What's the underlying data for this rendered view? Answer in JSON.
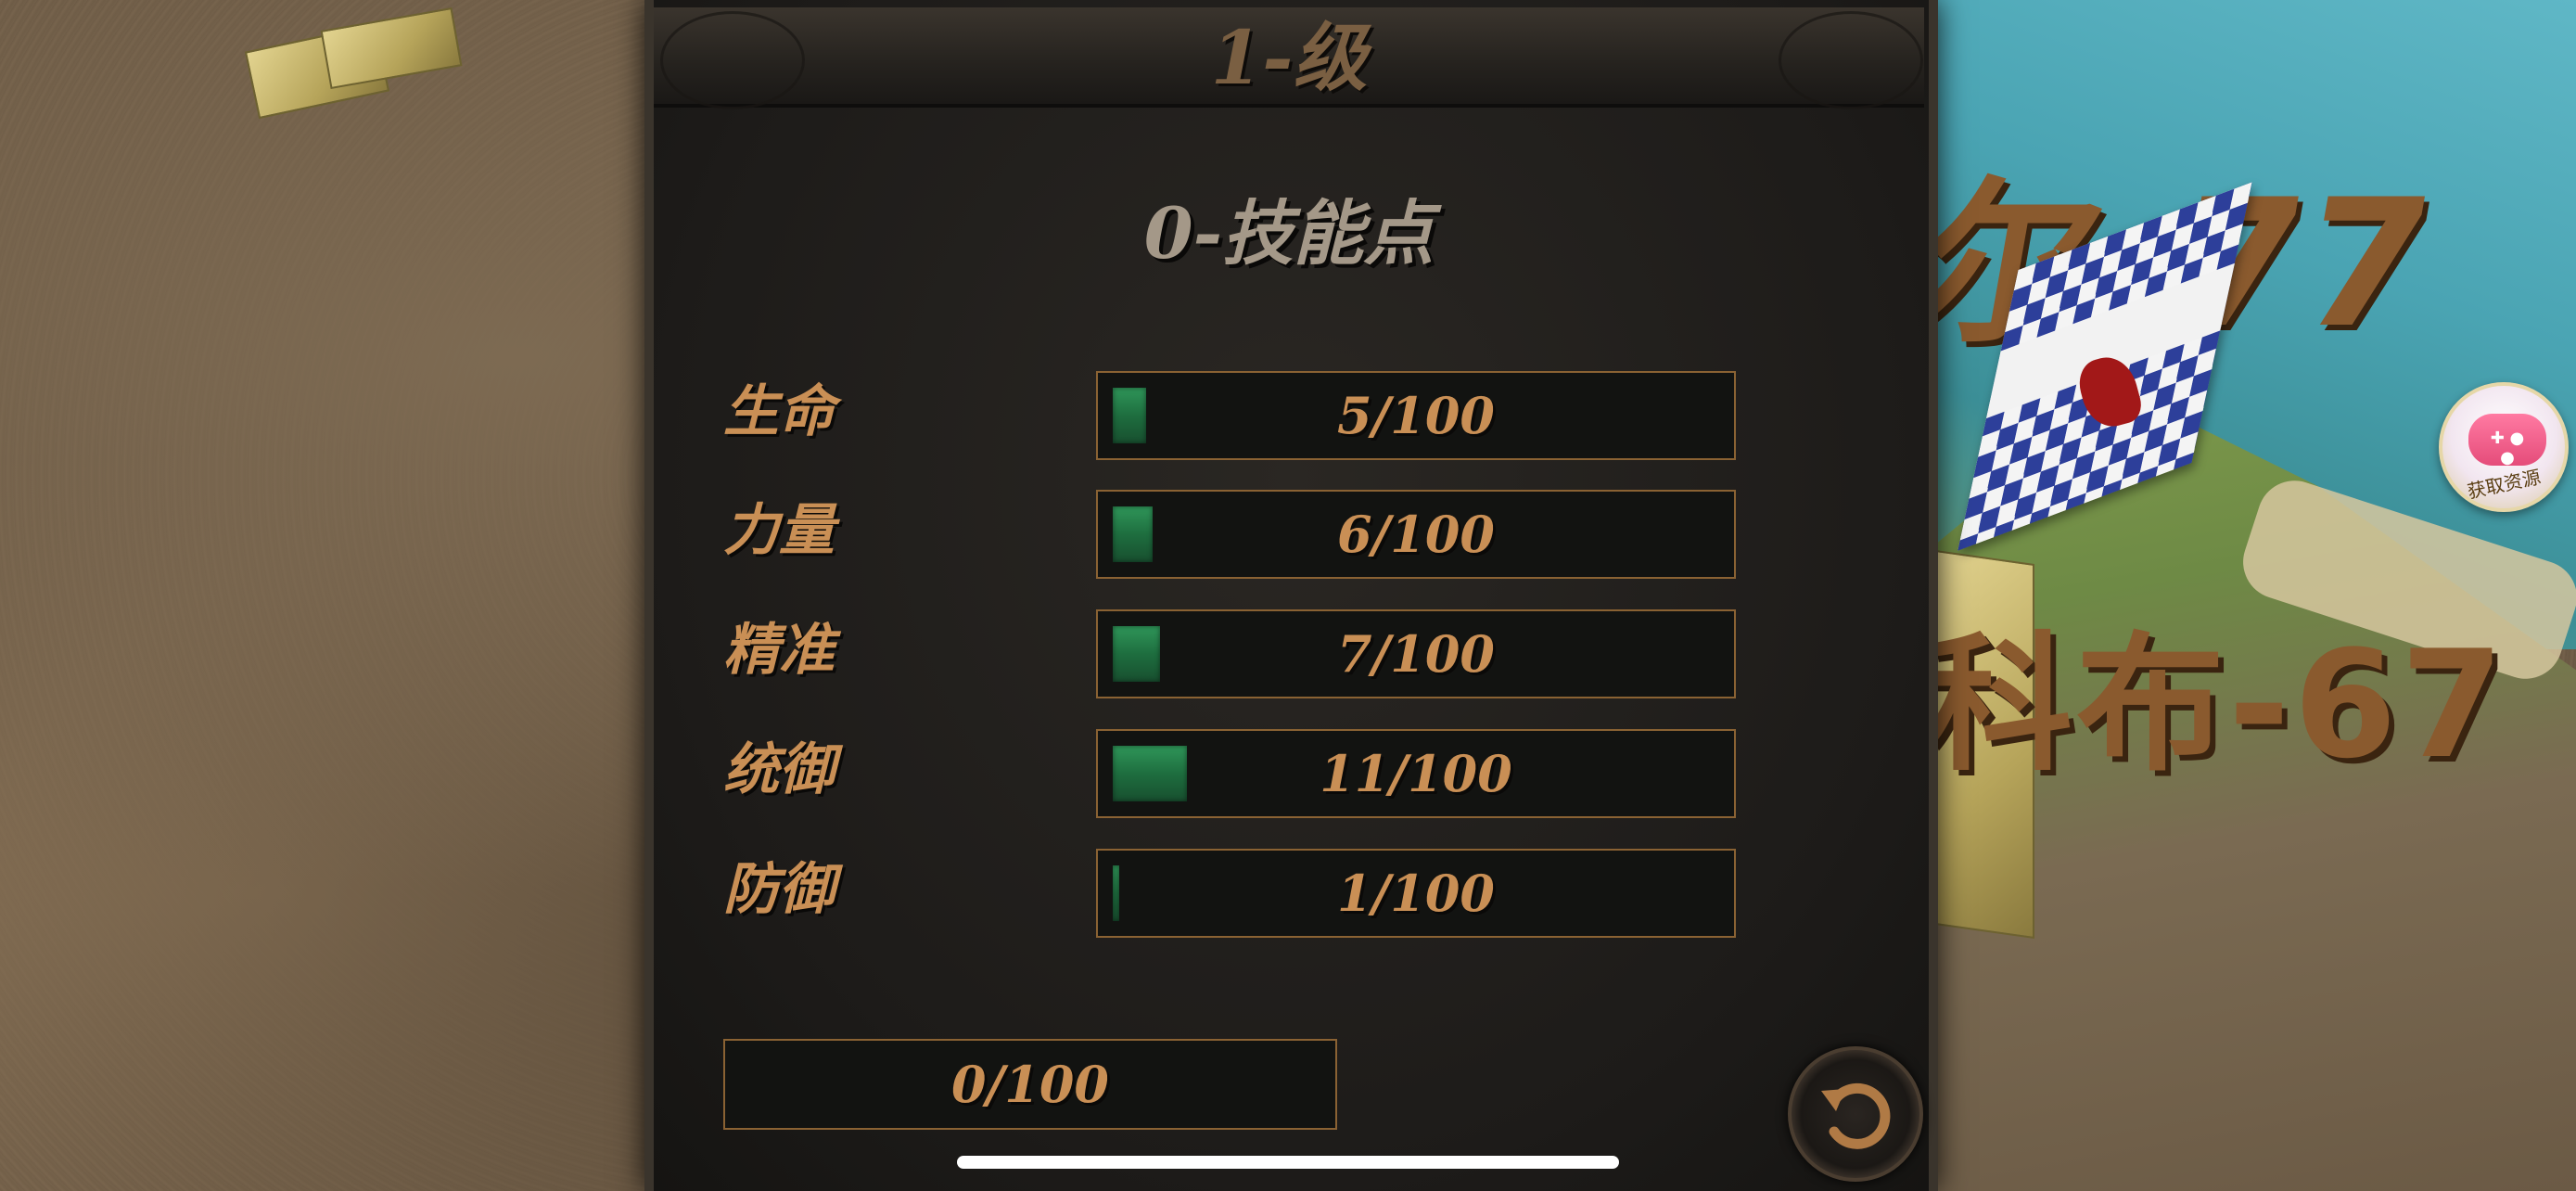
{
  "panel": {
    "title": "1-级",
    "skill_points": "0-技能点",
    "stats": [
      {
        "label": "生命",
        "value_text": "5/100",
        "value": 5,
        "max": 100
      },
      {
        "label": "力量",
        "value_text": "6/100",
        "value": 6,
        "max": 100
      },
      {
        "label": "精准",
        "value_text": "7/100",
        "value": 7,
        "max": 100
      },
      {
        "label": "统御",
        "value_text": "11/100",
        "value": 11,
        "max": 100
      },
      {
        "label": "防御",
        "value_text": "1/100",
        "value": 1,
        "max": 100
      }
    ],
    "experience": {
      "value_text": "0/100",
      "value": 0,
      "max": 100
    },
    "back_icon": "undo-arrow-icon"
  },
  "world": {
    "name_tag_top": "尔-77",
    "name_tag_bottom": "科布-67"
  },
  "overlay": {
    "float_button_label": "获取资源",
    "float_button_icon": "gamepad-icon"
  },
  "colors": {
    "accent_text": "#c98f55",
    "bar_fill": "#2f9659",
    "bar_border": "#8a6233"
  }
}
